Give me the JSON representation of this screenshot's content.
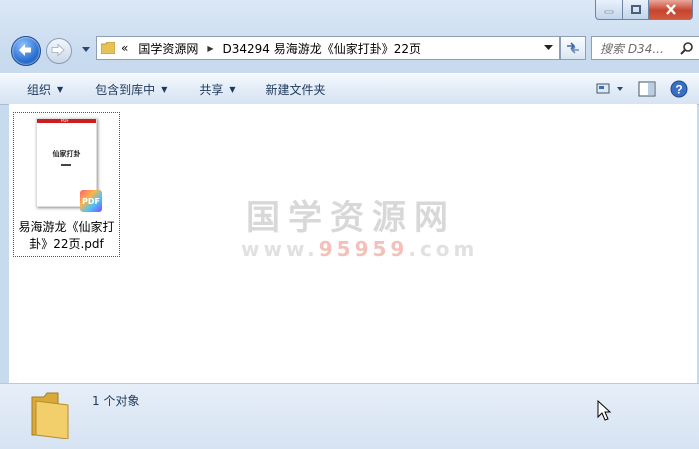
{
  "address": {
    "overflow": "«",
    "crumbs": [
      "国学资源网",
      "D34294 易海游龙《仙家打卦》22页"
    ]
  },
  "search": {
    "placeholder": "搜索 D34..."
  },
  "toolbar": {
    "organize": "组织",
    "include_library": "包含到库中",
    "share": "共享",
    "new_folder": "新建文件夹"
  },
  "file": {
    "name": "易海游龙《仙家打卦》22页.pdf",
    "name_line1": "易海游龙《仙家打",
    "name_line2": "卦》22页.pdf",
    "thumb_header": "PDF",
    "thumb_title": "仙家打卦",
    "badge": "PDF"
  },
  "watermark": {
    "title": "国学资源网",
    "url_a": "www.",
    "url_b": "95959",
    "url_c": ".com"
  },
  "details": {
    "count": "1 个对象"
  },
  "colors": {
    "accent": "#1e395b",
    "close": "#c7442f",
    "pdf_red": "#cf1d1d"
  }
}
